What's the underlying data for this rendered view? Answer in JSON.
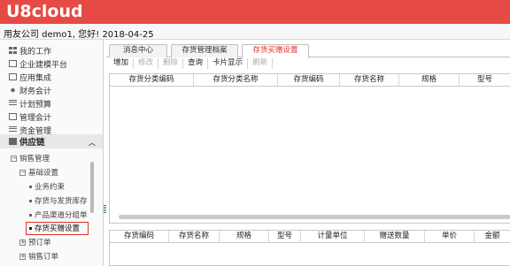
{
  "header": {
    "logo": "U8cloud"
  },
  "infobar": {
    "text": "用友公司 demo1, 您好! 2018-04-25"
  },
  "sidebar": {
    "modules": [
      {
        "label": "我的工作",
        "icon": "grid-icon"
      },
      {
        "label": "企业建模平台",
        "icon": "box-icon"
      },
      {
        "label": "应用集成",
        "icon": "box-icon"
      },
      {
        "label": "财务会计",
        "icon": "dot-icon"
      },
      {
        "label": "计划预算",
        "icon": "chart-icon"
      },
      {
        "label": "管理会计",
        "icon": "box-icon"
      },
      {
        "label": "资金管理",
        "icon": "bars-icon"
      }
    ],
    "active_module": {
      "label": "供应链",
      "icon": "warehouse-icon"
    },
    "tree": {
      "sales": "销售管理",
      "basic": "基础设置",
      "items": [
        "业务约束",
        "存货与发货库存",
        "产品渠道分组单",
        "存货买赠设置"
      ],
      "after": [
        "预订单",
        "销售订单"
      ]
    }
  },
  "tabs": [
    {
      "label": "消息中心"
    },
    {
      "label": "存货管理档案"
    },
    {
      "label": "存货买赠设置"
    }
  ],
  "toolbar": [
    "增加",
    "修改",
    "删除",
    "查询",
    "卡片显示",
    "刷新"
  ],
  "grid1": {
    "columns": [
      "存货分类编码",
      "存货分类名称",
      "存货编码",
      "存货名称",
      "规格",
      "型号"
    ]
  },
  "grid2": {
    "columns": [
      "存货编码",
      "存货名称",
      "规格",
      "型号",
      "计量单位",
      "赠送数量",
      "单价",
      "金额"
    ]
  }
}
